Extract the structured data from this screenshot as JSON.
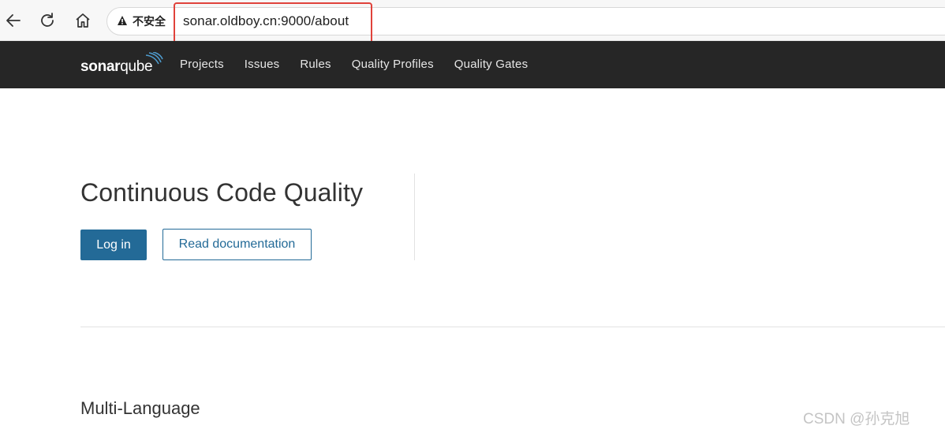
{
  "browser": {
    "security_label": "不安全",
    "url": "sonar.oldboy.cn:9000/about",
    "icons": [
      "back-arrow-icon",
      "reload-icon",
      "home-icon",
      "warning-icon"
    ],
    "highlight_color": "#e0423b"
  },
  "nav": {
    "logo": {
      "bold": "sonar",
      "light": "qube"
    },
    "items": [
      "Projects",
      "Issues",
      "Rules",
      "Quality Profiles",
      "Quality Gates"
    ],
    "background": "#262626"
  },
  "hero": {
    "title": "Continuous Code Quality",
    "login_label": "Log in",
    "docs_label": "Read documentation",
    "accent": "#236a97"
  },
  "section": {
    "title": "Multi-Language"
  },
  "watermark": "CSDN @孙克旭"
}
